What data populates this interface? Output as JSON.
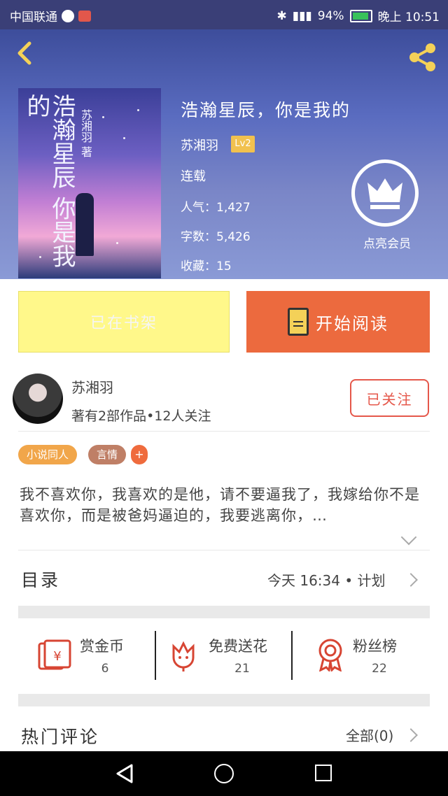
{
  "status_bar": {
    "carrier": "中国联通",
    "battery": "94%",
    "time": "晚上 10:51"
  },
  "header": {
    "title": "浩瀚星辰，你是我的",
    "author": "苏湘羽",
    "level": "Lv2",
    "status": "连载",
    "popularity": "人气：1,427",
    "word_count": "字数：5,426",
    "favorites": "收藏：15",
    "vip_label": "点亮会员",
    "cover_title": "浩瀚星辰 你是我的",
    "cover_author": "苏湘羽 著"
  },
  "actions": {
    "shelf_label": "已在书架",
    "read_label": "开始阅读"
  },
  "author_card": {
    "name": "苏湘羽",
    "info": "著有2部作品•12人关注",
    "follow_label": "已关注"
  },
  "tags": [
    "小说同人",
    "言情"
  ],
  "tag_add": "+",
  "description": "我不喜欢你，我喜欢的是他，请不要逼我了，我嫁给你不是喜欢你，而是被爸妈逼迫的，我要逃离你，…",
  "catalog": {
    "title": "目录",
    "info": "今天 16:34 • 计划"
  },
  "stats": [
    {
      "label": "赏金币",
      "value": "6",
      "icon": "red-envelope-icon"
    },
    {
      "label": "免费送花",
      "value": "21",
      "icon": "flower-icon"
    },
    {
      "label": "粉丝榜",
      "value": "22",
      "icon": "medal-icon"
    }
  ],
  "comments": {
    "title": "热门评论",
    "all_label": "全部(0)"
  },
  "colors": {
    "accent": "#ec6a3e",
    "shelf": "#fff88a",
    "icon_red": "#d74533"
  }
}
